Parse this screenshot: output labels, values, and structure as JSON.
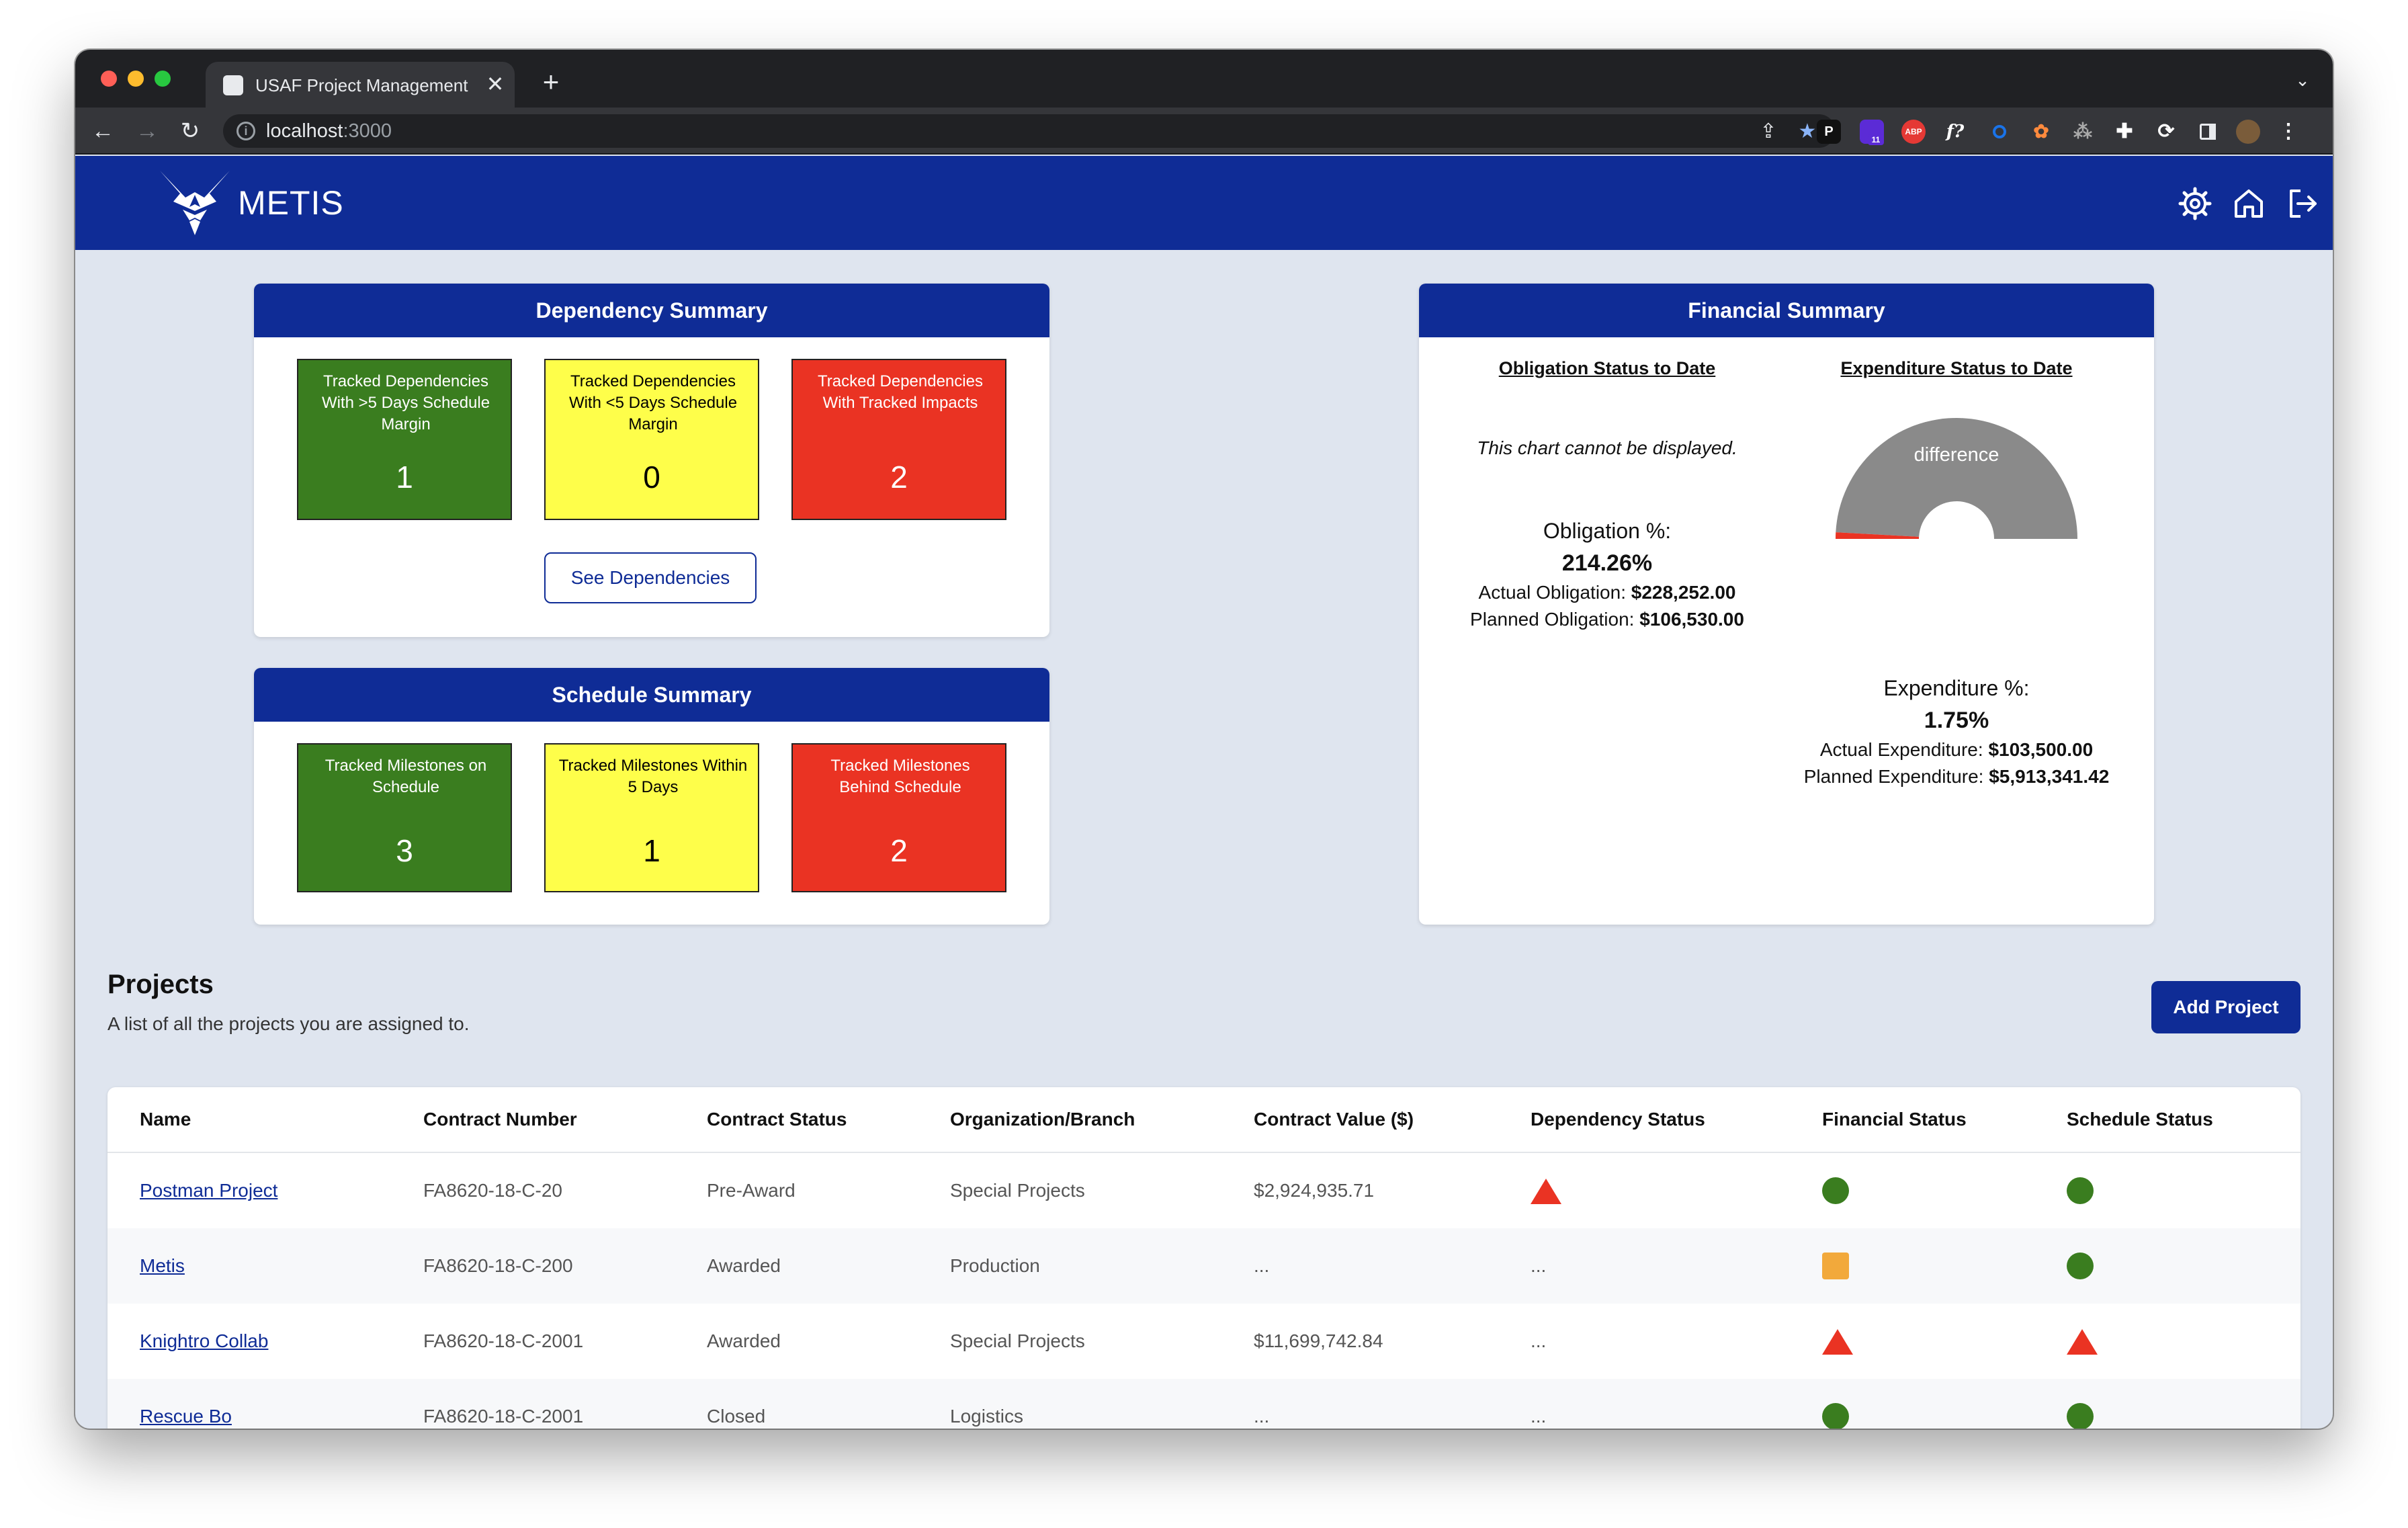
{
  "browser": {
    "tab_title": "USAF Project Management Dashboard",
    "tab_close": "✕",
    "new_tab": "+",
    "url_host": "localhost",
    "url_port": ":3000",
    "extension_badge_count": "11",
    "ext_p": "P",
    "ext_abp": "ABP",
    "ext_fx": "f?"
  },
  "app": {
    "brand": "METIS"
  },
  "dependency_summary": {
    "title": "Dependency Summary",
    "tiles": [
      {
        "label": "Tracked Dependencies With >5 Days Schedule Margin",
        "value": "1",
        "color": "green"
      },
      {
        "label": "Tracked Dependencies With <5 Days Schedule Margin",
        "value": "0",
        "color": "yellow"
      },
      {
        "label": "Tracked Dependencies With Tracked Impacts",
        "value": "2",
        "color": "red"
      }
    ],
    "button_label": "See Dependencies"
  },
  "schedule_summary": {
    "title": "Schedule Summary",
    "tiles": [
      {
        "label": "Tracked Milestones on Schedule",
        "value": "3",
        "color": "green"
      },
      {
        "label": "Tracked Milestones Within 5 Days",
        "value": "1",
        "color": "yellow"
      },
      {
        "label": "Tracked Milestones Behind Schedule",
        "value": "2",
        "color": "red"
      }
    ]
  },
  "financial_summary": {
    "title": "Financial Summary",
    "obligation": {
      "heading": "Obligation Status to Date",
      "chart_message": "This chart cannot be displayed.",
      "pct_label": "Obligation %:",
      "pct_value": "214.26%",
      "actual_label": "Actual Obligation: ",
      "actual_value": "$228,252.00",
      "planned_label": "Planned Obligation: ",
      "planned_value": "$106,530.00"
    },
    "expenditure": {
      "heading": "Expenditure Status to Date",
      "gauge_label": "difference",
      "pct_label": "Expenditure %:",
      "pct_value": "1.75%",
      "actual_label": "Actual Expenditure: ",
      "actual_value": "$103,500.00",
      "planned_label": "Planned Expenditure: ",
      "planned_value": "$5,913,341.42"
    }
  },
  "chart_data": {
    "type": "pie",
    "title": "Expenditure Status to Date",
    "categories": [
      "Actual Expenditure",
      "difference"
    ],
    "values": [
      103500.0,
      5809841.42
    ],
    "colors": [
      "#ea3323",
      "#8a8a8a"
    ],
    "legend": "none"
  },
  "projects": {
    "title": "Projects",
    "subtitle": "A list of all the projects you are assigned to.",
    "add_button": "Add Project",
    "columns": [
      "Name",
      "Contract Number",
      "Contract Status",
      "Organization/Branch",
      "Contract Value ($)",
      "Dependency Status",
      "Financial Status",
      "Schedule Status"
    ],
    "rows": [
      {
        "name": "Postman Project",
        "contract_number": "FA8620-18-C-20",
        "contract_status": "Pre-Award",
        "org": "Special Projects",
        "value": "$2,924,935.71",
        "dependency": "red-triangle",
        "financial": "green-circle",
        "schedule": "green-circle"
      },
      {
        "name": "Metis",
        "contract_number": "FA8620-18-C-200",
        "contract_status": "Awarded",
        "org": "Production",
        "value": "...",
        "dependency": "...",
        "financial": "orange-square",
        "schedule": "green-circle"
      },
      {
        "name": "Knightro Collab",
        "contract_number": "FA8620-18-C-2001",
        "contract_status": "Awarded",
        "org": "Special Projects",
        "value": "$11,699,742.84",
        "dependency": "...",
        "financial": "red-triangle",
        "schedule": "red-triangle"
      },
      {
        "name": "Rescue Bo",
        "contract_number": "FA8620-18-C-2001",
        "contract_status": "Closed",
        "org": "Logistics",
        "value": "...",
        "dependency": "...",
        "financial": "green-circle",
        "schedule": "green-circle"
      }
    ]
  }
}
